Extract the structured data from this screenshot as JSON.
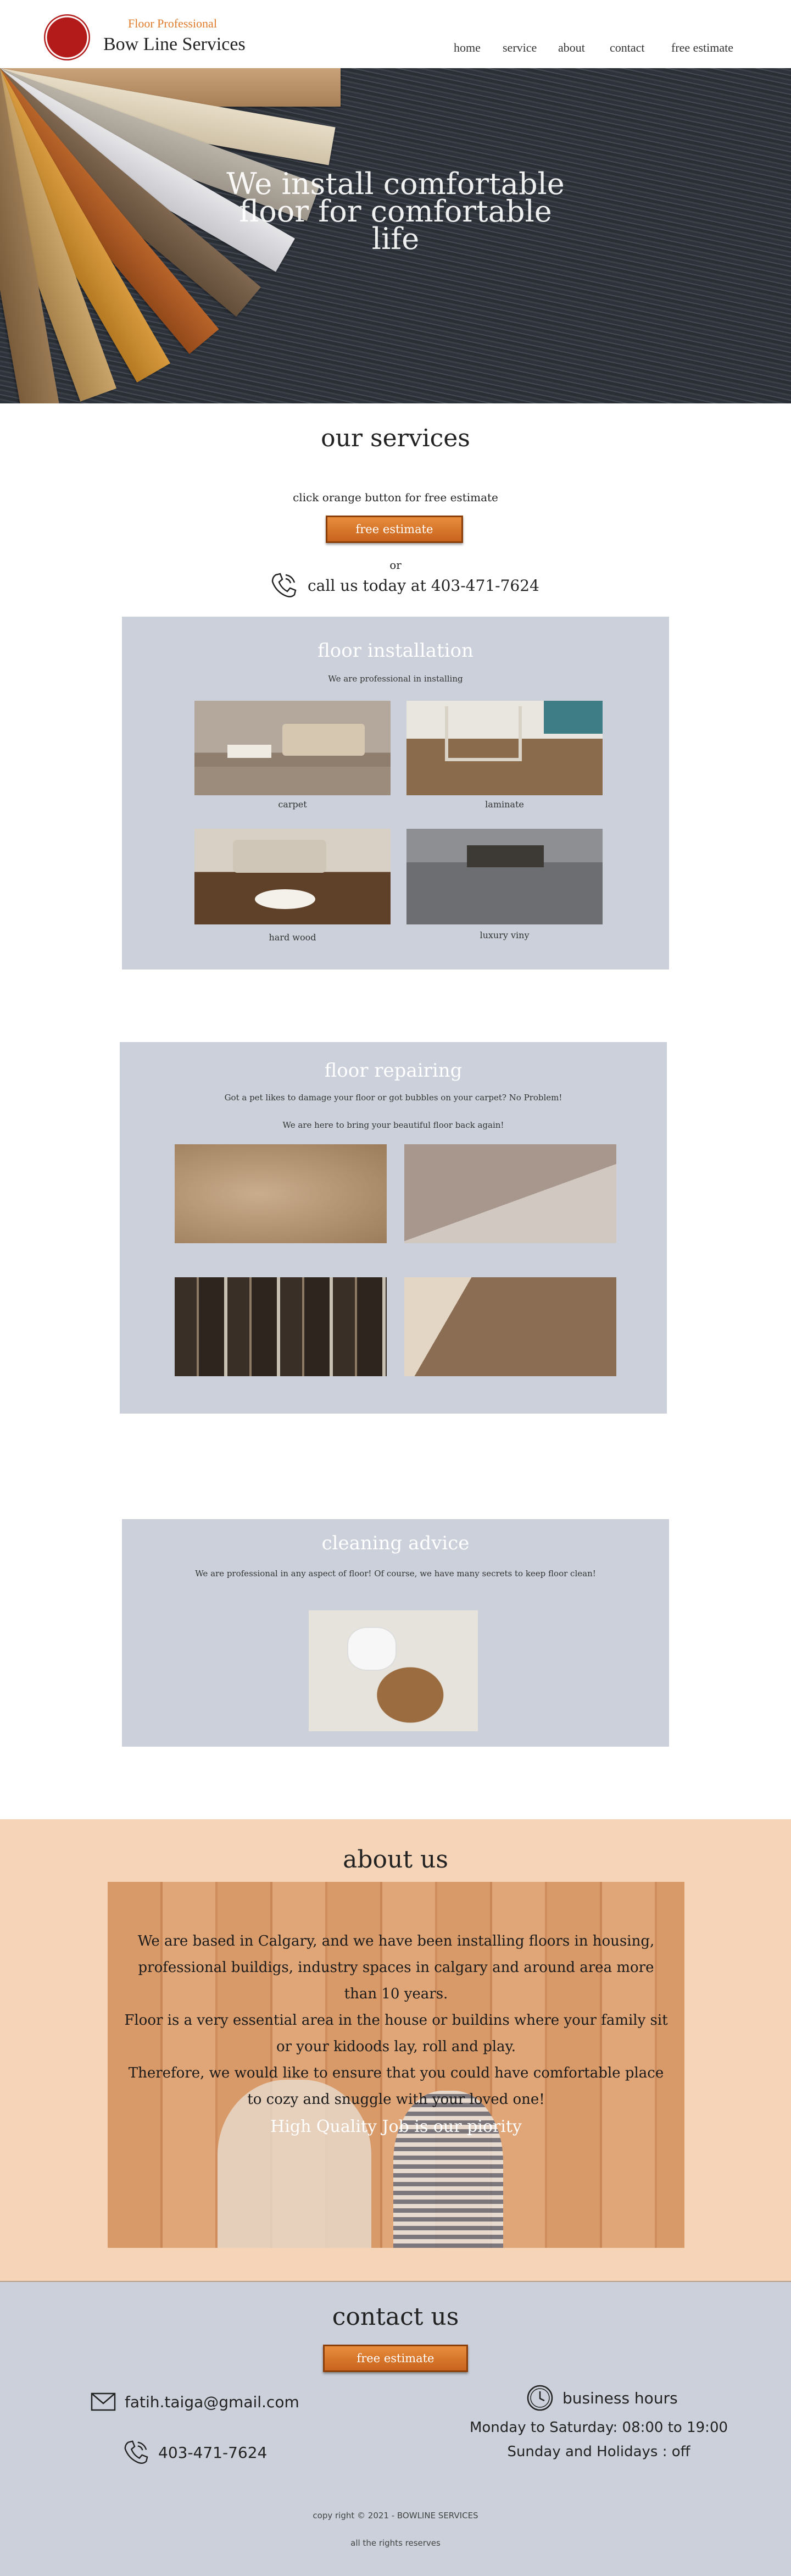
{
  "header": {
    "brand_sub": "Floor Professional",
    "brand_name": "Bow Line Services",
    "nav": [
      "home",
      "service",
      "about",
      "contact",
      "free estimate"
    ]
  },
  "hero": {
    "title": "We install comfortable floor for comfortable life"
  },
  "services": {
    "title": "our services",
    "instruction": "click orange button for free estimate",
    "button_label": "free estimate",
    "or_text": "or",
    "call_text": "call us today at 403-471-7624"
  },
  "installation": {
    "title": "floor installation",
    "subtitle": "We are professional in installing",
    "items": [
      "carpet",
      "laminate",
      "hard wood",
      "luxury viny"
    ]
  },
  "repairing": {
    "title": "floor repairing",
    "line1": "Got a pet likes to damage your floor or got bubbles on your carpet?  No Problem!",
    "line2": "We are here to bring your beautiful floor back again!"
  },
  "cleaning": {
    "title": "cleaning advice",
    "subtitle": "We are professional in any aspect of floor! Of course, we have many secrets to keep floor clean!"
  },
  "about": {
    "title": "about us",
    "lines": [
      "We are based in Calgary, and we have been installing floors in housing,",
      "professional buildigs, industry spaces in calgary and around area more",
      "than 10 years.",
      "Floor is a very essential area in the house or buildins where your family sit",
      "or your kidoods lay, roll and play.",
      "Therefore, we would like to ensure that you could have comfortable place",
      "to cozy and snuggle with your loved one!"
    ],
    "motto": "High Quality Job is our piority"
  },
  "contact": {
    "title": "contact us",
    "button_label": "free estimate",
    "email": "fatih.taiga@gmail.com",
    "phone": "403-471-7624",
    "hours_title": "business hours",
    "hours_weekday": "Monday to Saturday: 08:00  to 19:00",
    "hours_weekend": "Sunday and Holidays : off"
  },
  "footer": {
    "copyright": "copy right © 2021 - BOWLINE SERVICES",
    "rights": "all the rights reserves"
  },
  "colors": {
    "accent_orange": "#e07b2a",
    "panel_gray": "#cbd0da",
    "about_peach": "#f5d4b8",
    "logo_red": "#b31b1b"
  }
}
